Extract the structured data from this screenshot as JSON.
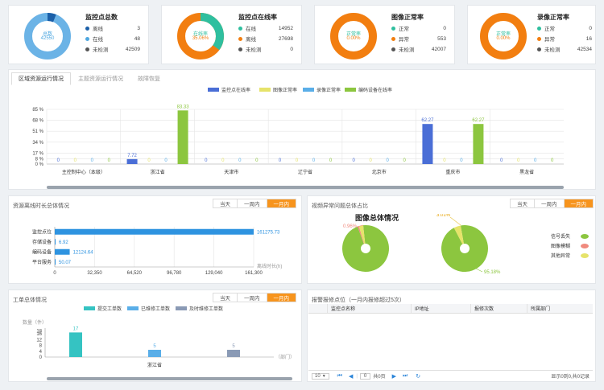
{
  "kpis": [
    {
      "title": "监控点总数",
      "center_label": "总数",
      "center_value": "42550",
      "rows": [
        {
          "label": "离线",
          "value": "3",
          "color": "#1b5fa8"
        },
        {
          "label": "在线",
          "value": "48",
          "color": "#4ea7e0"
        },
        {
          "label": "未检测",
          "value": "42509",
          "color": "#555555"
        }
      ],
      "ring_color": "#6bb3e6",
      "accent_color": "#1b5fa8",
      "accent_fraction": 0.06
    },
    {
      "title": "监控点在线率",
      "center_label": "在线率",
      "center_value": "35.06%",
      "rows": [
        {
          "label": "在线",
          "value": "14952",
          "color": "#2fbf9f"
        },
        {
          "label": "离线",
          "value": "27698",
          "color": "#f27e10"
        },
        {
          "label": "未检测",
          "value": "0",
          "color": "#555555"
        }
      ],
      "ring_color": "#f27e10",
      "accent_color": "#2fbf9f",
      "accent_fraction": 0.35
    },
    {
      "title": "图像正常率",
      "center_label": "正常率",
      "center_value": "0.00%",
      "rows": [
        {
          "label": "正常",
          "value": "0",
          "color": "#2fbf9f"
        },
        {
          "label": "异常",
          "value": "553",
          "color": "#f27e10"
        },
        {
          "label": "未检测",
          "value": "42007",
          "color": "#555555"
        }
      ],
      "ring_color": "#f27e10",
      "accent_color": "#2fbf9f",
      "accent_fraction": 0
    },
    {
      "title": "录像正常率",
      "center_label": "正常率",
      "center_value": "0.00%",
      "rows": [
        {
          "label": "正常",
          "value": "0",
          "color": "#2fbf9f"
        },
        {
          "label": "异常",
          "value": "16",
          "color": "#f27e10"
        },
        {
          "label": "未检测",
          "value": "42534",
          "color": "#555555"
        }
      ],
      "ring_color": "#f27e10",
      "accent_color": "#2fbf9f",
      "accent_fraction": 0
    }
  ],
  "tabs": [
    "区域资源运行情况",
    "主题资源运行情况",
    "故障恢复"
  ],
  "period_options": [
    "当天",
    "一周内",
    "一月内"
  ],
  "resource_panel": {
    "title": "资源离线时长总体情况"
  },
  "image_panel": {
    "title": "视频异常问题总体占比",
    "chart_title": "图像总体情况"
  },
  "ticket_panel": {
    "title": "工单总体情况"
  },
  "alarm_panel": {
    "title": "报警报修点位（一月内报修超过5次）",
    "columns": [
      "监控点名称",
      "IP地址",
      "报修次数",
      "所属部门"
    ]
  },
  "pager": {
    "page_size": "10",
    "page_input": "0",
    "page_total": "共0页",
    "summary": "显示0到0,共0记录"
  },
  "chart_data": [
    {
      "type": "bar",
      "categories": [
        "主控制中心（本级）",
        "浙江省",
        "天津市",
        "辽宁省",
        "北京市",
        "重庆市",
        "黑龙省"
      ],
      "series": [
        {
          "name": "监控点在线率",
          "color": "#4a6ed6",
          "values": [
            0,
            7.72,
            0,
            0,
            0,
            62.27,
            0
          ]
        },
        {
          "name": "图像正常率",
          "color": "#e6e36a",
          "values": [
            0,
            0,
            0,
            0,
            0,
            0,
            0
          ]
        },
        {
          "name": "录像正常率",
          "color": "#5aaee8",
          "values": [
            0,
            0,
            0,
            0,
            0,
            0,
            0
          ]
        },
        {
          "name": "编码设备在线率",
          "color": "#8cc63f",
          "values": [
            0,
            83.33,
            0,
            0,
            0,
            62.27,
            0
          ]
        }
      ],
      "yticks": [
        "0 %",
        "8 %",
        "17 %",
        "34 %",
        "51 %",
        "68 %",
        "85 %"
      ],
      "ylim": [
        0,
        85
      ]
    },
    {
      "type": "bar",
      "orientation": "horizontal",
      "categories": [
        "监控点位",
        "存储设备",
        "编码设备",
        "平台服务"
      ],
      "values": [
        161275.73,
        6.92,
        12124.64,
        50.07
      ],
      "xticks": [
        "0",
        "32,350",
        "64,520",
        "96,780",
        "129,040",
        "161,300"
      ],
      "xlabel": "离线时长(h)",
      "color": "#2e93e0",
      "xlim": [
        0,
        161300
      ]
    },
    {
      "type": "pie",
      "legend": [
        {
          "name": "信号丢失",
          "color": "#8cc63f"
        },
        {
          "name": "图像模糊",
          "color": "#f08a7e"
        },
        {
          "name": "其他异常",
          "color": "#e6e36a"
        }
      ],
      "pies": [
        {
          "slices": [
            {
              "label": "信号丢失",
              "value": 96.03
            },
            {
              "label": "图像模糊",
              "value": 0.96
            },
            {
              "label": "其他异常",
              "value": 3.01
            }
          ],
          "callouts": [
            "0.96%",
            "3.01%"
          ]
        },
        {
          "slices": [
            {
              "label": "信号丢失",
              "value": 95.18
            },
            {
              "label": "其他异常",
              "value": 4.82
            }
          ],
          "callouts": [
            "95.18%"
          ]
        }
      ]
    },
    {
      "type": "bar",
      "categories": [
        "浙江省"
      ],
      "series": [
        {
          "name": "提交工单数",
          "color": "#35c3c2",
          "values": [
            17
          ]
        },
        {
          "name": "已维修工单数",
          "color": "#5aaee8",
          "values": [
            5
          ]
        },
        {
          "name": "及时维修工单数",
          "color": "#8a9ab5",
          "values": [
            5
          ]
        }
      ],
      "yticks": [
        "0",
        "4",
        "8",
        "12",
        "16",
        "18"
      ],
      "ylabel": "数量（件）",
      "xlabel": "（部门）",
      "ylim": [
        0,
        20
      ]
    }
  ]
}
